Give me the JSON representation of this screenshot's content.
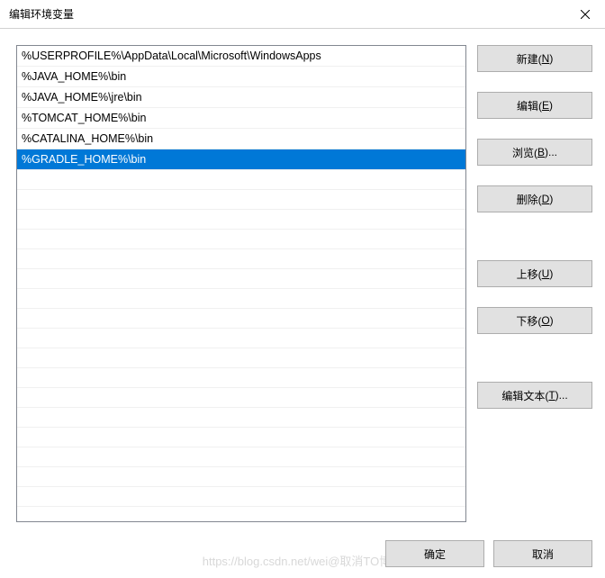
{
  "title": "编辑环境变量",
  "list": {
    "items": [
      "%USERPROFILE%\\AppData\\Local\\Microsoft\\WindowsApps",
      "%JAVA_HOME%\\bin",
      "%JAVA_HOME%\\jre\\bin",
      "%TOMCAT_HOME%\\bin",
      "%CATALINA_HOME%\\bin",
      "%GRADLE_HOME%\\bin"
    ],
    "selected_index": 5
  },
  "buttons": {
    "new": {
      "text": "新建(",
      "key": "N",
      "suffix": ")"
    },
    "edit": {
      "text": "编辑(",
      "key": "E",
      "suffix": ")"
    },
    "browse": {
      "text": "浏览(",
      "key": "B",
      "suffix": ")..."
    },
    "delete": {
      "text": "删除(",
      "key": "D",
      "suffix": ")"
    },
    "moveup": {
      "text": "上移(",
      "key": "U",
      "suffix": ")"
    },
    "movedown": {
      "text": "下移(",
      "key": "O",
      "suffix": ")"
    },
    "edittext": {
      "text": "编辑文本(",
      "key": "T",
      "suffix": ")..."
    },
    "ok": "确定",
    "cancel": "取消"
  },
  "watermark": "https://blog.csdn.net/wei@取消TO博客"
}
